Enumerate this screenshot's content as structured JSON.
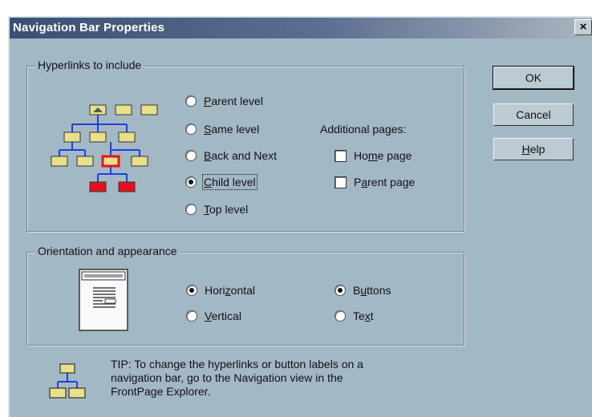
{
  "dialog": {
    "title": "Navigation Bar Properties",
    "close_label": "×"
  },
  "hyperlinks": {
    "legend": "Hyperlinks to include",
    "options": [
      {
        "pre": "",
        "key": "P",
        "post": "arent level",
        "selected": false
      },
      {
        "pre": "",
        "key": "S",
        "post": "ame level",
        "selected": false
      },
      {
        "pre": "",
        "key": "B",
        "post": "ack and Next",
        "selected": false
      },
      {
        "pre": "",
        "key": "C",
        "post": "hild level",
        "selected": true
      },
      {
        "pre": "",
        "key": "T",
        "post": "op level",
        "selected": false
      }
    ],
    "additional_label": "Additional pages:",
    "additional": [
      {
        "pre": "Ho",
        "key": "m",
        "post": "e page",
        "checked": false
      },
      {
        "pre": "P",
        "key": "a",
        "post": "rent page",
        "checked": false
      }
    ]
  },
  "orientation": {
    "legend": "Orientation and appearance",
    "orient_options": [
      {
        "pre": "Hori",
        "key": "z",
        "post": "ontal",
        "selected": true
      },
      {
        "pre": "",
        "key": "V",
        "post": "ertical",
        "selected": false
      }
    ],
    "appearance_options": [
      {
        "pre": "B",
        "key": "u",
        "post": "ttons",
        "selected": true
      },
      {
        "pre": "Te",
        "key": "x",
        "post": "t",
        "selected": false
      }
    ]
  },
  "buttons": {
    "ok": "OK",
    "cancel": "Cancel",
    "help_key": "H",
    "help_rest": "elp"
  },
  "tip": {
    "lines": [
      "TIP: To change the hyperlinks or button labels on a",
      "navigation bar, go to the Navigation view in the",
      "FrontPage Explorer."
    ]
  },
  "colors": {
    "dialog_bg": "#a3b8c5",
    "page_fill": "#e8e08a",
    "highlight": "#e8101c",
    "tree_line": "#1f3fe0"
  },
  "icons": {
    "tree": "navigation-tree-diagram-icon",
    "page_layout": "page-layout-icon",
    "tip": "site-structure-icon",
    "close": "close-icon"
  }
}
